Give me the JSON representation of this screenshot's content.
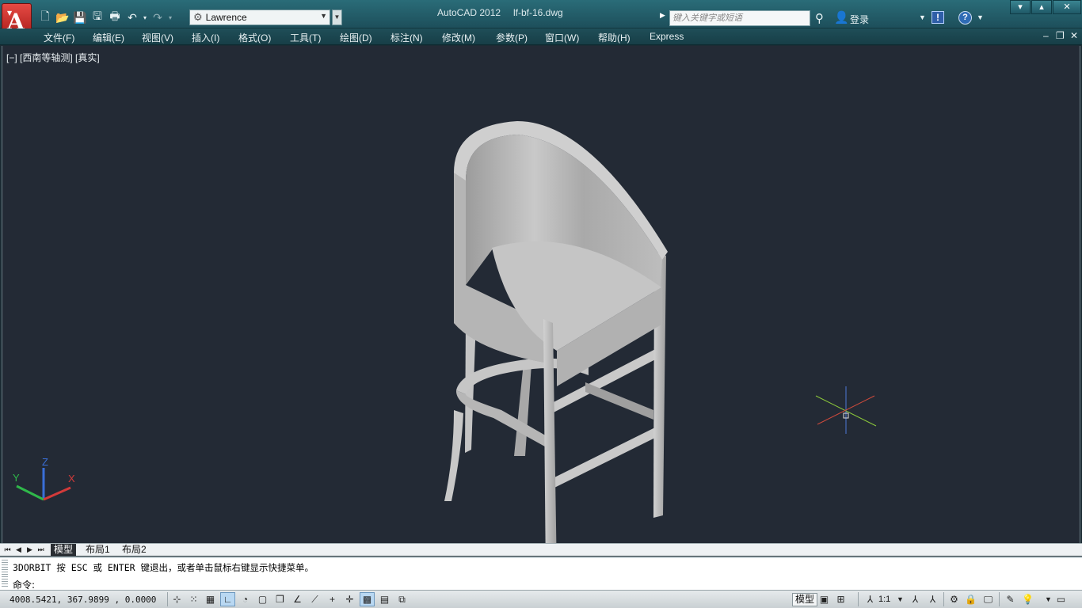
{
  "app": {
    "title": "AutoCAD 2012",
    "file": "lf-bf-16.dwg"
  },
  "qat": {
    "workspace": "Lawrence"
  },
  "search": {
    "placeholder": "键入关键字或短语"
  },
  "account": {
    "login_label": "登录"
  },
  "help": {
    "label": "?"
  },
  "menu": {
    "items": [
      "文件(F)",
      "编辑(E)",
      "视图(V)",
      "插入(I)",
      "格式(O)",
      "工具(T)",
      "绘图(D)",
      "标注(N)",
      "修改(M)",
      "参数(P)",
      "窗口(W)",
      "帮助(H)",
      "Express"
    ]
  },
  "viewport": {
    "label": "[−] [西南等轴测] [真实]",
    "ucs_axes": {
      "x": "X",
      "y": "Y",
      "z": "Z"
    }
  },
  "layout_tabs": {
    "items": [
      "模型",
      "布局1",
      "布局2"
    ],
    "active": "模型"
  },
  "command": {
    "history": "3DORBIT 按 ESC 或 ENTER 键退出，或者单击鼠标右键显示快捷菜单。",
    "prompt": "命令:"
  },
  "status": {
    "coordinates": "4008.5421,  367.9899 ,  0.0000",
    "model_label": "模型",
    "annotation_scale": "1:1"
  },
  "colors": {
    "titlebar": "#1d4f5b",
    "viewport_bg": "#232a35",
    "app_button": "#c0221f",
    "chair_fill": "#bdbdbd"
  }
}
